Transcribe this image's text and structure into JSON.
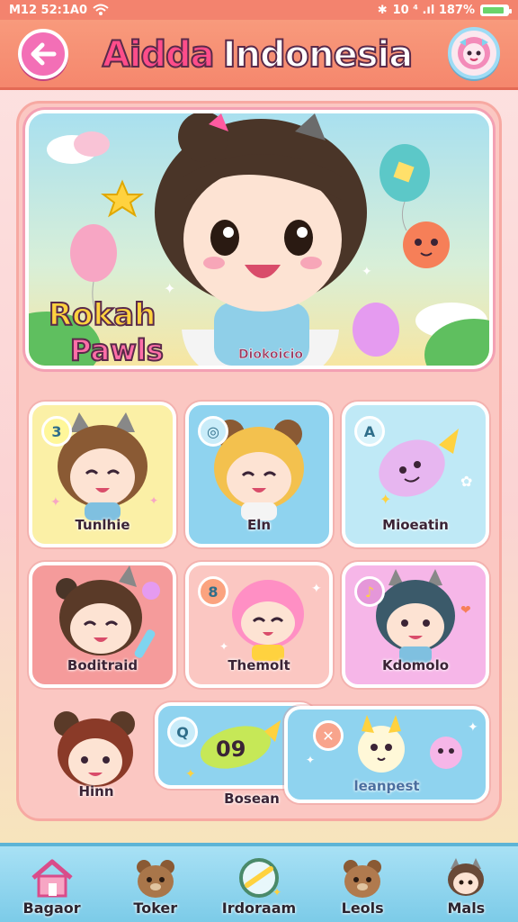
{
  "status_bar": {
    "time": "M12 52:1A0",
    "right_text": "10 ⁴ .ıl 187%",
    "battery_fraction": 0.87
  },
  "header": {
    "title_part_1": "Aidda",
    "title_part_2": "Indonesia",
    "back_icon": "back-arrow-icon",
    "profile_icon": "profile-avatar-icon"
  },
  "banner": {
    "logo_line_1": "Rokah",
    "logo_line_2": "Pawls",
    "character_name": "Diokoicio"
  },
  "cards": [
    {
      "label": "Tunlhie",
      "badge": "3",
      "color": "#fbf0a6"
    },
    {
      "label": "Eln",
      "badge": "◎",
      "color": "#8fd3ef"
    },
    {
      "label": "Mioeatin",
      "badge": "A",
      "color": "#bfe9f6"
    },
    {
      "label": "Boditraid",
      "badge": "",
      "color": "#f59b9b"
    },
    {
      "label": "Themolt",
      "badge": "8",
      "color": "#fbc7c2"
    },
    {
      "label": "Kdomolo",
      "badge": "♪",
      "color": "#f6b6e8"
    },
    {
      "label": "Hinn",
      "badge": "",
      "color": "#fbc7c2"
    },
    {
      "label": "Bosean",
      "badge": "Q",
      "color": "#8fd3ef"
    },
    {
      "label": "leanpest",
      "badge": "✕",
      "color": "#8fd3ef"
    }
  ],
  "bottom_nav": [
    {
      "label": "Bagaor",
      "icon": "home-icon"
    },
    {
      "label": "Toker",
      "icon": "bear-icon"
    },
    {
      "label": "Irdoraam",
      "icon": "compass-icon"
    },
    {
      "label": "Leols",
      "icon": "bear-friend-icon"
    },
    {
      "label": "Mals",
      "icon": "cat-girl-icon"
    }
  ],
  "colors": {
    "header": "#f5876d",
    "accent_pink": "#ff4d8a",
    "nav_blue": "#7ccbe8"
  }
}
